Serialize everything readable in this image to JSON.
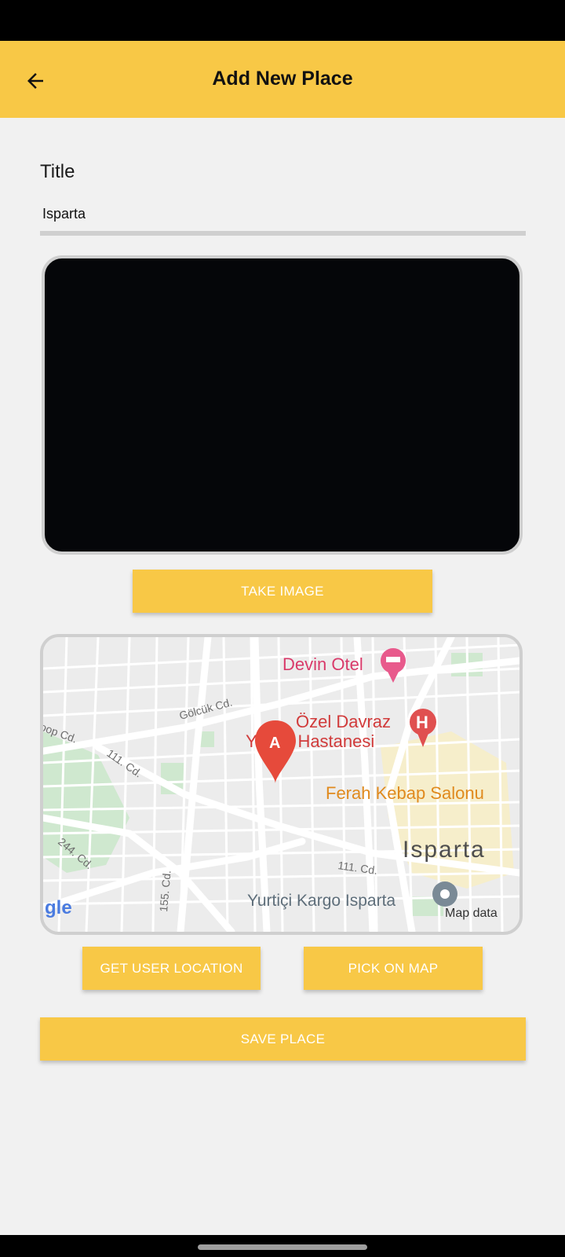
{
  "app_bar": {
    "title": "Add New Place",
    "back_icon": "arrow-back-icon",
    "color": "#f8c846"
  },
  "form": {
    "title_label": "Title",
    "title_value": "Isparta"
  },
  "image_section": {
    "take_image_label": "TAKE IMAGE"
  },
  "map": {
    "marker_letter": "A",
    "labels": {
      "hotel": "Devin Otel",
      "hospital_line1": "Özel Davraz",
      "hospital_line2": "Y",
      "hospital_line2b": "m Hastanesi",
      "restaurant": "Ferah Kebap Salonu",
      "city": "Isparta",
      "cargo": "Yurtiçi Kargo Isparta",
      "road_golcuk": "Gölcük Cd.",
      "road_top": "oop Cd.",
      "road_111a": "111. Cd.",
      "road_111b": "111. Cd.",
      "road_244": "244. Cd.",
      "road_155": "155. Cd.",
      "logo": "gle",
      "attribution": "Map data"
    }
  },
  "buttons": {
    "get_location": "GET USER LOCATION",
    "pick_on_map": "PICK ON MAP",
    "save_place": "SAVE PLACE"
  }
}
